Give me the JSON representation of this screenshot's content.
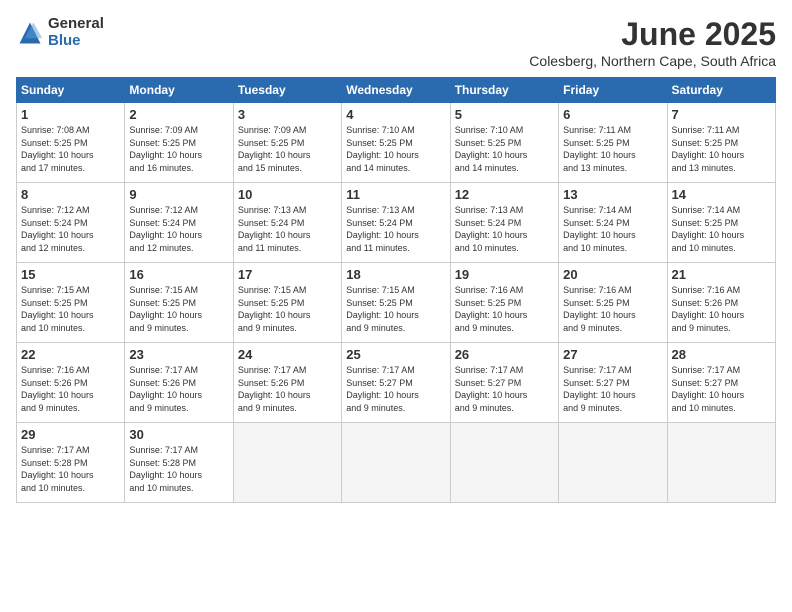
{
  "logo": {
    "general": "General",
    "blue": "Blue"
  },
  "title": "June 2025",
  "location": "Colesberg, Northern Cape, South Africa",
  "days_of_week": [
    "Sunday",
    "Monday",
    "Tuesday",
    "Wednesday",
    "Thursday",
    "Friday",
    "Saturday"
  ],
  "weeks": [
    [
      {
        "day": "1",
        "info": "Sunrise: 7:08 AM\nSunset: 5:25 PM\nDaylight: 10 hours\nand 17 minutes."
      },
      {
        "day": "2",
        "info": "Sunrise: 7:09 AM\nSunset: 5:25 PM\nDaylight: 10 hours\nand 16 minutes."
      },
      {
        "day": "3",
        "info": "Sunrise: 7:09 AM\nSunset: 5:25 PM\nDaylight: 10 hours\nand 15 minutes."
      },
      {
        "day": "4",
        "info": "Sunrise: 7:10 AM\nSunset: 5:25 PM\nDaylight: 10 hours\nand 14 minutes."
      },
      {
        "day": "5",
        "info": "Sunrise: 7:10 AM\nSunset: 5:25 PM\nDaylight: 10 hours\nand 14 minutes."
      },
      {
        "day": "6",
        "info": "Sunrise: 7:11 AM\nSunset: 5:25 PM\nDaylight: 10 hours\nand 13 minutes."
      },
      {
        "day": "7",
        "info": "Sunrise: 7:11 AM\nSunset: 5:25 PM\nDaylight: 10 hours\nand 13 minutes."
      }
    ],
    [
      {
        "day": "8",
        "info": "Sunrise: 7:12 AM\nSunset: 5:24 PM\nDaylight: 10 hours\nand 12 minutes."
      },
      {
        "day": "9",
        "info": "Sunrise: 7:12 AM\nSunset: 5:24 PM\nDaylight: 10 hours\nand 12 minutes."
      },
      {
        "day": "10",
        "info": "Sunrise: 7:13 AM\nSunset: 5:24 PM\nDaylight: 10 hours\nand 11 minutes."
      },
      {
        "day": "11",
        "info": "Sunrise: 7:13 AM\nSunset: 5:24 PM\nDaylight: 10 hours\nand 11 minutes."
      },
      {
        "day": "12",
        "info": "Sunrise: 7:13 AM\nSunset: 5:24 PM\nDaylight: 10 hours\nand 10 minutes."
      },
      {
        "day": "13",
        "info": "Sunrise: 7:14 AM\nSunset: 5:24 PM\nDaylight: 10 hours\nand 10 minutes."
      },
      {
        "day": "14",
        "info": "Sunrise: 7:14 AM\nSunset: 5:25 PM\nDaylight: 10 hours\nand 10 minutes."
      }
    ],
    [
      {
        "day": "15",
        "info": "Sunrise: 7:15 AM\nSunset: 5:25 PM\nDaylight: 10 hours\nand 10 minutes."
      },
      {
        "day": "16",
        "info": "Sunrise: 7:15 AM\nSunset: 5:25 PM\nDaylight: 10 hours\nand 9 minutes."
      },
      {
        "day": "17",
        "info": "Sunrise: 7:15 AM\nSunset: 5:25 PM\nDaylight: 10 hours\nand 9 minutes."
      },
      {
        "day": "18",
        "info": "Sunrise: 7:15 AM\nSunset: 5:25 PM\nDaylight: 10 hours\nand 9 minutes."
      },
      {
        "day": "19",
        "info": "Sunrise: 7:16 AM\nSunset: 5:25 PM\nDaylight: 10 hours\nand 9 minutes."
      },
      {
        "day": "20",
        "info": "Sunrise: 7:16 AM\nSunset: 5:25 PM\nDaylight: 10 hours\nand 9 minutes."
      },
      {
        "day": "21",
        "info": "Sunrise: 7:16 AM\nSunset: 5:26 PM\nDaylight: 10 hours\nand 9 minutes."
      }
    ],
    [
      {
        "day": "22",
        "info": "Sunrise: 7:16 AM\nSunset: 5:26 PM\nDaylight: 10 hours\nand 9 minutes."
      },
      {
        "day": "23",
        "info": "Sunrise: 7:17 AM\nSunset: 5:26 PM\nDaylight: 10 hours\nand 9 minutes."
      },
      {
        "day": "24",
        "info": "Sunrise: 7:17 AM\nSunset: 5:26 PM\nDaylight: 10 hours\nand 9 minutes."
      },
      {
        "day": "25",
        "info": "Sunrise: 7:17 AM\nSunset: 5:27 PM\nDaylight: 10 hours\nand 9 minutes."
      },
      {
        "day": "26",
        "info": "Sunrise: 7:17 AM\nSunset: 5:27 PM\nDaylight: 10 hours\nand 9 minutes."
      },
      {
        "day": "27",
        "info": "Sunrise: 7:17 AM\nSunset: 5:27 PM\nDaylight: 10 hours\nand 9 minutes."
      },
      {
        "day": "28",
        "info": "Sunrise: 7:17 AM\nSunset: 5:27 PM\nDaylight: 10 hours\nand 10 minutes."
      }
    ],
    [
      {
        "day": "29",
        "info": "Sunrise: 7:17 AM\nSunset: 5:28 PM\nDaylight: 10 hours\nand 10 minutes."
      },
      {
        "day": "30",
        "info": "Sunrise: 7:17 AM\nSunset: 5:28 PM\nDaylight: 10 hours\nand 10 minutes."
      },
      {
        "day": "",
        "info": ""
      },
      {
        "day": "",
        "info": ""
      },
      {
        "day": "",
        "info": ""
      },
      {
        "day": "",
        "info": ""
      },
      {
        "day": "",
        "info": ""
      }
    ]
  ]
}
